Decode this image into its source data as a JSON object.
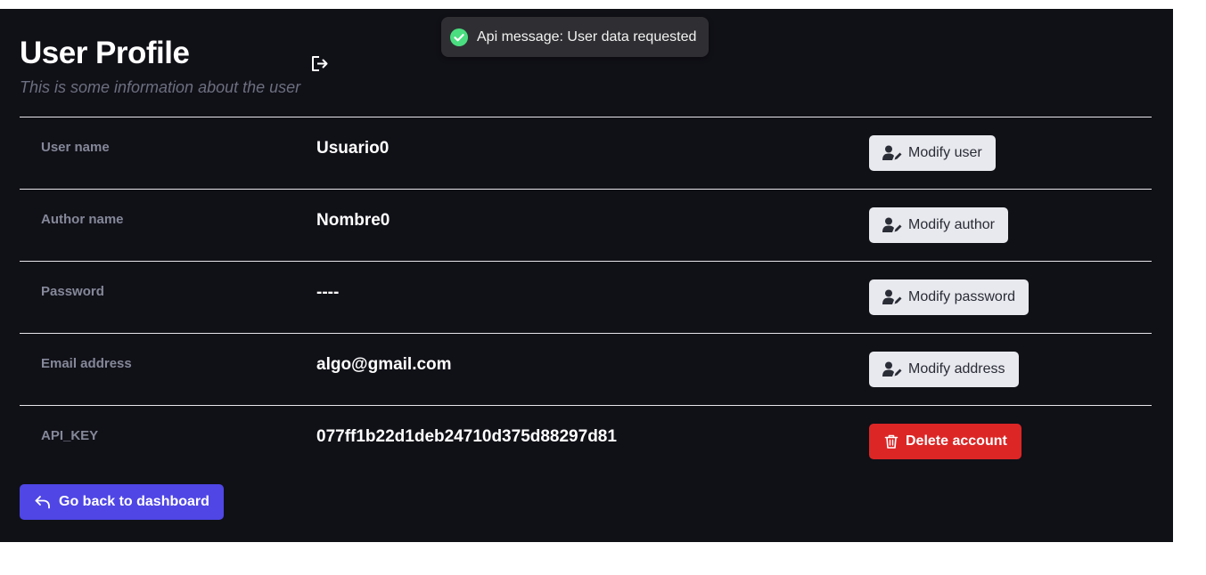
{
  "header": {
    "title": "User Profile",
    "subtitle": "This is some information about the user",
    "logout_icon": "logout-icon"
  },
  "toast": {
    "icon": "check-circle-icon",
    "message": "Api message: User data requested",
    "status_color": "#4ade80"
  },
  "fields": [
    {
      "label": "User name",
      "value": "Usuario0",
      "button_label": "Modify user",
      "button_icon": "user-edit-icon"
    },
    {
      "label": "Author name",
      "value": "Nombre0",
      "button_label": "Modify author",
      "button_icon": "user-edit-icon"
    },
    {
      "label": "Password",
      "value": "----",
      "button_label": "Modify password",
      "button_icon": "user-edit-icon"
    },
    {
      "label": "Email address",
      "value": "algo@gmail.com",
      "button_label": "Modify address",
      "button_icon": "user-edit-icon"
    },
    {
      "label": "API_KEY",
      "value": "077ff1b22d1deb24710d375d88297d81",
      "button_label": "Delete account",
      "button_icon": "trash-icon"
    }
  ],
  "back_button": {
    "label": "Go back to dashboard",
    "icon": "arrow-back-icon"
  },
  "colors": {
    "background": "#101017",
    "accent": "#4f46e5",
    "danger": "#dc2626",
    "button_light": "#e8e9ee"
  }
}
